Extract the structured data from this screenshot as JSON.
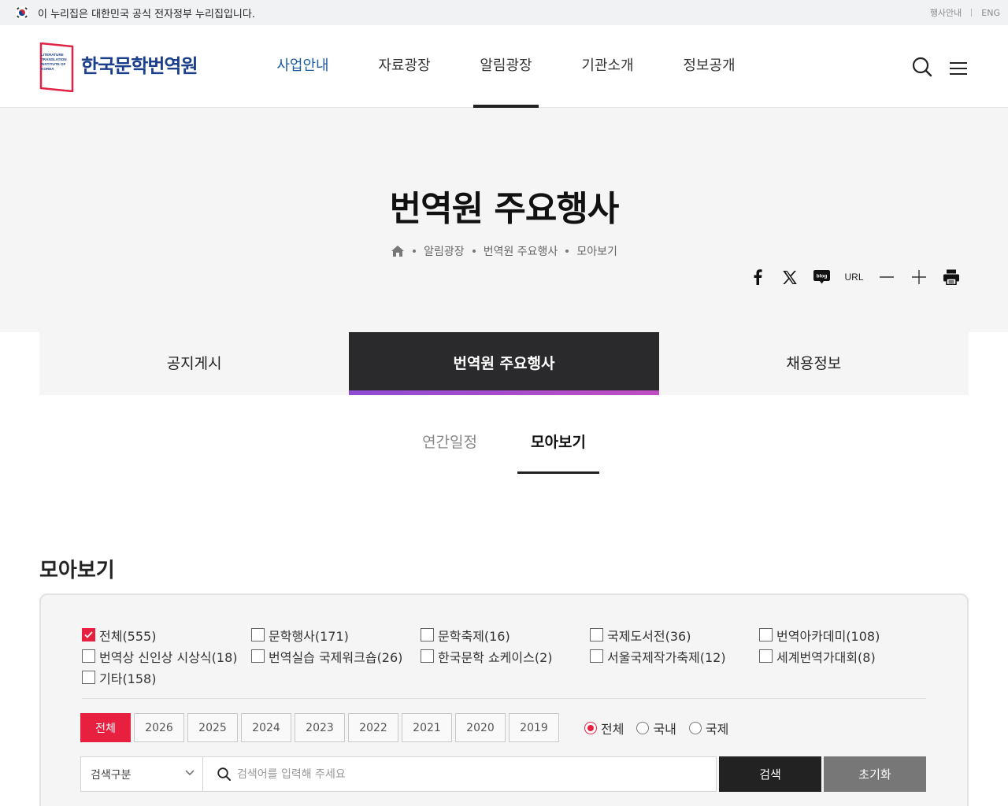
{
  "gov_banner": {
    "text": "이 누리집은 대한민국 공식 전자정부 누리집입니다.",
    "links": [
      "행사안내",
      "ENG"
    ]
  },
  "header": {
    "logo_text": "한국문학번역원",
    "logo_small_lines": [
      "LITERATURE",
      "TRANSLATION",
      "INSTITUTE OF",
      "KOREA"
    ],
    "nav": [
      "사업안내",
      "자료광장",
      "알림광장",
      "기관소개",
      "정보공개"
    ],
    "current_nav": "알림광장"
  },
  "page": {
    "title": "번역원 주요행사",
    "breadcrumb": [
      "알림광장",
      "번역원 주요행사",
      "모아보기"
    ],
    "share": {
      "url_label": "URL",
      "blog_label": "blog"
    }
  },
  "tabs": [
    "공지게시",
    "번역원 주요행사",
    "채용정보"
  ],
  "active_tab": "번역원 주요행사",
  "subtabs": [
    "연간일정",
    "모아보기"
  ],
  "active_subtab": "모아보기",
  "section": {
    "title": "모아보기",
    "categories": [
      {
        "label": "전체(555)",
        "checked": true
      },
      {
        "label": "문학행사(171)",
        "checked": false
      },
      {
        "label": "문학축제(16)",
        "checked": false
      },
      {
        "label": "국제도서전(36)",
        "checked": false
      },
      {
        "label": "번역아카데미(108)",
        "checked": false
      },
      {
        "label": "번역상 신인상 시상식(18)",
        "checked": false
      },
      {
        "label": "번역실습 국제워크숍(26)",
        "checked": false
      },
      {
        "label": "한국문학 쇼케이스(2)",
        "checked": false
      },
      {
        "label": "서울국제작가축제(12)",
        "checked": false
      },
      {
        "label": "세계번역가대회(8)",
        "checked": false
      },
      {
        "label": "기타(158)",
        "checked": false
      }
    ],
    "years": [
      "전체",
      "2026",
      "2025",
      "2024",
      "2023",
      "2022",
      "2021",
      "2020",
      "2019"
    ],
    "selected_year": "전체",
    "regions": [
      "전체",
      "국내",
      "국제"
    ],
    "selected_region": "전체",
    "search": {
      "select_label": "검색구분",
      "placeholder": "검색어를 입력해 주세요",
      "value": "",
      "search_label": "검색",
      "reset_label": "초기화"
    }
  },
  "colors": {
    "accent": "#e8203f",
    "nav_active": "#1c5a9e",
    "logo": "#1c3f8c",
    "dark": "#2a2a2c"
  }
}
